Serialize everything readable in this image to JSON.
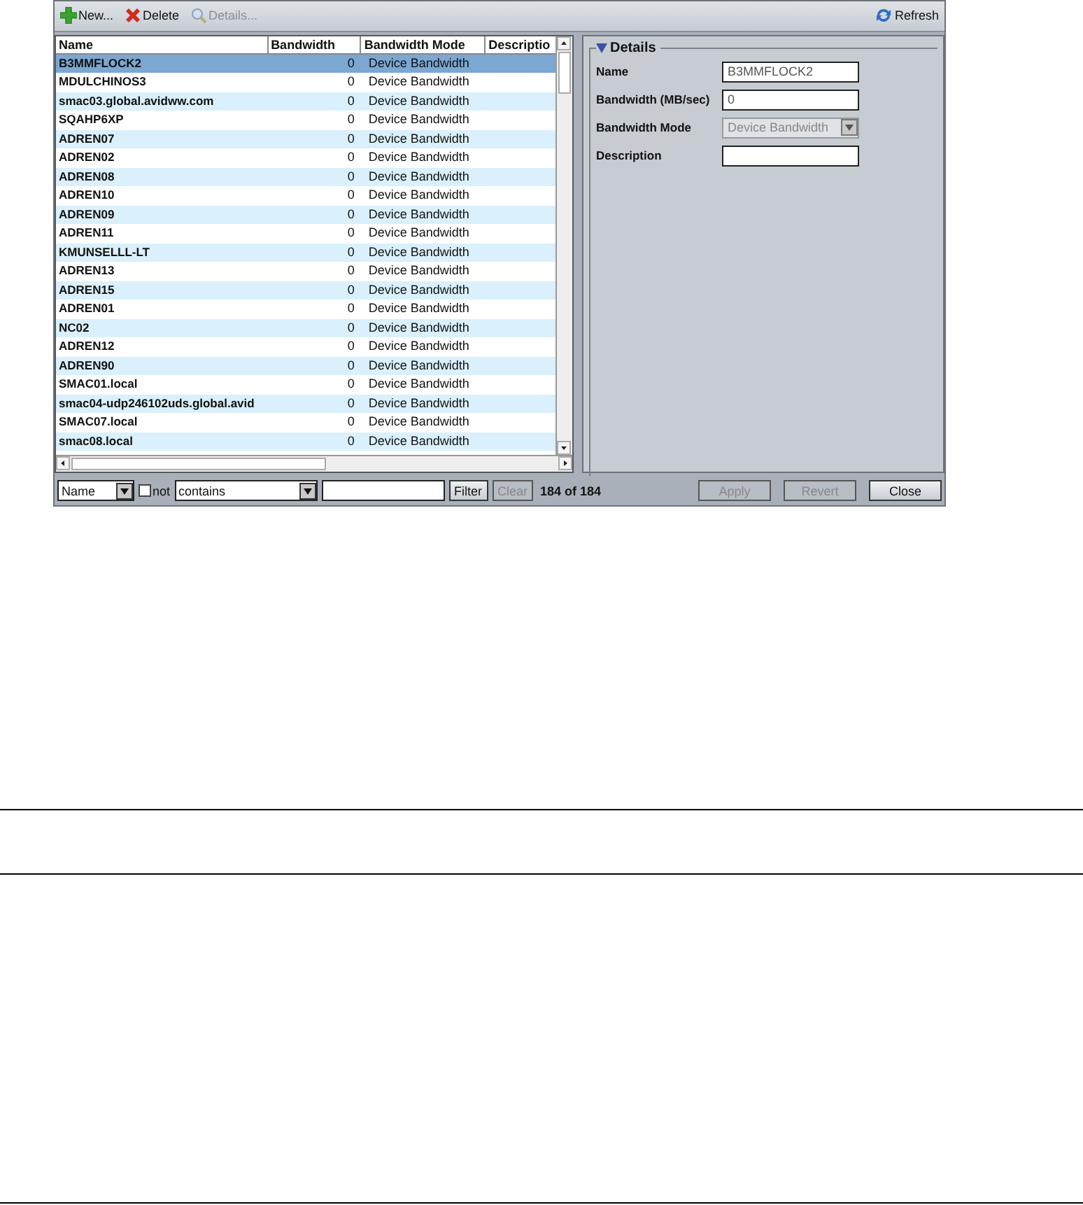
{
  "toolbar": {
    "buttons": [
      {
        "label": "New...",
        "disabled": false
      },
      {
        "label": "Delete",
        "disabled": false
      },
      {
        "label": "Details...",
        "disabled": true
      }
    ],
    "refresh": {
      "label": "Refresh"
    }
  },
  "table": {
    "columns": [
      "Name",
      "Bandwidth",
      "Bandwidth Mode",
      "Descriptio"
    ],
    "rows": [
      {
        "name": "B3MMFLOCK2",
        "bandwidth": "0",
        "mode": "Device Bandwidth",
        "selected": true
      },
      {
        "name": "MDULCHINOS3",
        "bandwidth": "0",
        "mode": "Device Bandwidth",
        "selected": false
      },
      {
        "name": "smac03.global.avidww.com",
        "bandwidth": "0",
        "mode": "Device Bandwidth",
        "selected": false
      },
      {
        "name": "SQAHP6XP",
        "bandwidth": "0",
        "mode": "Device Bandwidth",
        "selected": false
      },
      {
        "name": "ADREN07",
        "bandwidth": "0",
        "mode": "Device Bandwidth",
        "selected": false
      },
      {
        "name": "ADREN02",
        "bandwidth": "0",
        "mode": "Device Bandwidth",
        "selected": false
      },
      {
        "name": "ADREN08",
        "bandwidth": "0",
        "mode": "Device Bandwidth",
        "selected": false
      },
      {
        "name": "ADREN10",
        "bandwidth": "0",
        "mode": "Device Bandwidth",
        "selected": false
      },
      {
        "name": "ADREN09",
        "bandwidth": "0",
        "mode": "Device Bandwidth",
        "selected": false
      },
      {
        "name": "ADREN11",
        "bandwidth": "0",
        "mode": "Device Bandwidth",
        "selected": false
      },
      {
        "name": "KMUNSELLL-LT",
        "bandwidth": "0",
        "mode": "Device Bandwidth",
        "selected": false
      },
      {
        "name": "ADREN13",
        "bandwidth": "0",
        "mode": "Device Bandwidth",
        "selected": false
      },
      {
        "name": "ADREN15",
        "bandwidth": "0",
        "mode": "Device Bandwidth",
        "selected": false
      },
      {
        "name": "ADREN01",
        "bandwidth": "0",
        "mode": "Device Bandwidth",
        "selected": false
      },
      {
        "name": "NC02",
        "bandwidth": "0",
        "mode": "Device Bandwidth",
        "selected": false
      },
      {
        "name": "ADREN12",
        "bandwidth": "0",
        "mode": "Device Bandwidth",
        "selected": false
      },
      {
        "name": "ADREN90",
        "bandwidth": "0",
        "mode": "Device Bandwidth",
        "selected": false
      },
      {
        "name": "SMAC01.local",
        "bandwidth": "0",
        "mode": "Device Bandwidth",
        "selected": false
      },
      {
        "name": "smac04-udp246102uds.global.avid",
        "bandwidth": "0",
        "mode": "Device Bandwidth",
        "selected": false
      },
      {
        "name": "SMAC07.local",
        "bandwidth": "0",
        "mode": "Device Bandwidth",
        "selected": false
      },
      {
        "name": "smac08.local",
        "bandwidth": "0",
        "mode": "Device Bandwidth",
        "selected": false
      }
    ]
  },
  "filter": {
    "field": "Name",
    "not_checked": false,
    "not_label": "not",
    "operator": "contains",
    "filter_button": {
      "label": "Filter",
      "disabled": false
    },
    "clear_button": {
      "label": "Clear",
      "disabled": true
    },
    "count": "184 of 184"
  },
  "details": {
    "title": "Details",
    "expanded": true,
    "fields": [
      {
        "label": "Name",
        "kind": "text",
        "value": "B3MMFLOCK2",
        "disabled": false
      },
      {
        "label": "Bandwidth (MB/sec)",
        "kind": "text",
        "value": "0",
        "disabled": false
      },
      {
        "label": "Bandwidth Mode",
        "kind": "select",
        "value": "Device Bandwidth",
        "disabled": true
      },
      {
        "label": "Description",
        "kind": "text",
        "disabled": false
      }
    ]
  },
  "buttons": [
    {
      "label": "Apply",
      "disabled": true
    },
    {
      "label": "Revert",
      "disabled": true
    },
    {
      "label": "Close",
      "disabled": false
    }
  ]
}
